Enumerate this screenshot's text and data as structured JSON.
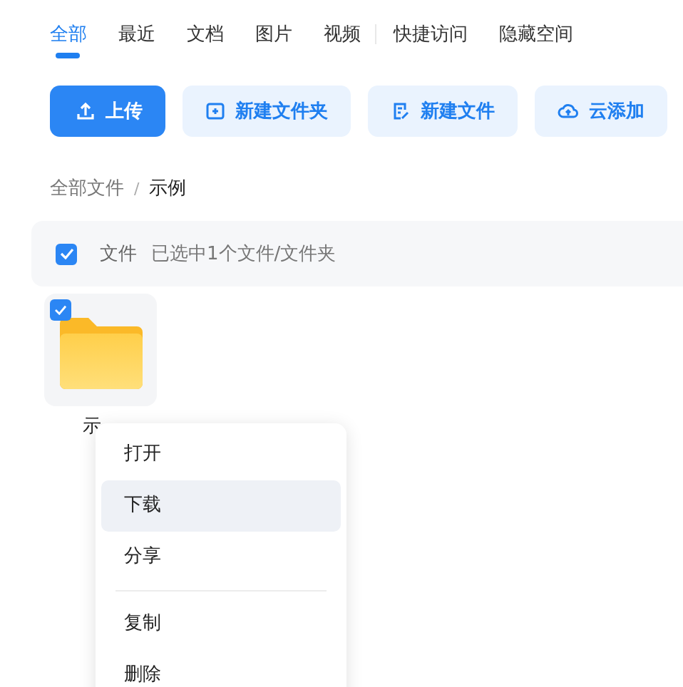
{
  "tabs": [
    {
      "label": "全部",
      "selected": true
    },
    {
      "label": "最近",
      "selected": false
    },
    {
      "label": "文档",
      "selected": false
    },
    {
      "label": "图片",
      "selected": false
    },
    {
      "label": "视频",
      "selected": false
    },
    {
      "label": "快捷访问",
      "selected": false
    },
    {
      "label": "隐藏空间",
      "selected": false
    }
  ],
  "actions": [
    {
      "label": "上传",
      "kind": "upload",
      "primary": true
    },
    {
      "label": "新建文件夹",
      "kind": "new-folder",
      "primary": false
    },
    {
      "label": "新建文件",
      "kind": "new-file",
      "primary": false
    },
    {
      "label": "云添加",
      "kind": "cloud",
      "primary": false
    }
  ],
  "breadcrumb": [
    {
      "label": "全部文件"
    },
    {
      "label": "/"
    },
    {
      "label": "示例"
    }
  ],
  "selection_bar": {
    "checked": true,
    "column": "文件",
    "status": "已选中1个文件/文件夹"
  },
  "files": [
    {
      "name": "示",
      "checked": true
    }
  ],
  "context_menu": [
    {
      "kind": "item",
      "label": "打开",
      "highlighted": false
    },
    {
      "kind": "item",
      "label": "下载",
      "highlighted": true
    },
    {
      "kind": "item",
      "label": "分享",
      "highlighted": false
    },
    {
      "kind": "divider"
    },
    {
      "kind": "item",
      "label": "复制",
      "highlighted": false
    },
    {
      "kind": "item",
      "label": "删除",
      "highlighted": false
    }
  ]
}
